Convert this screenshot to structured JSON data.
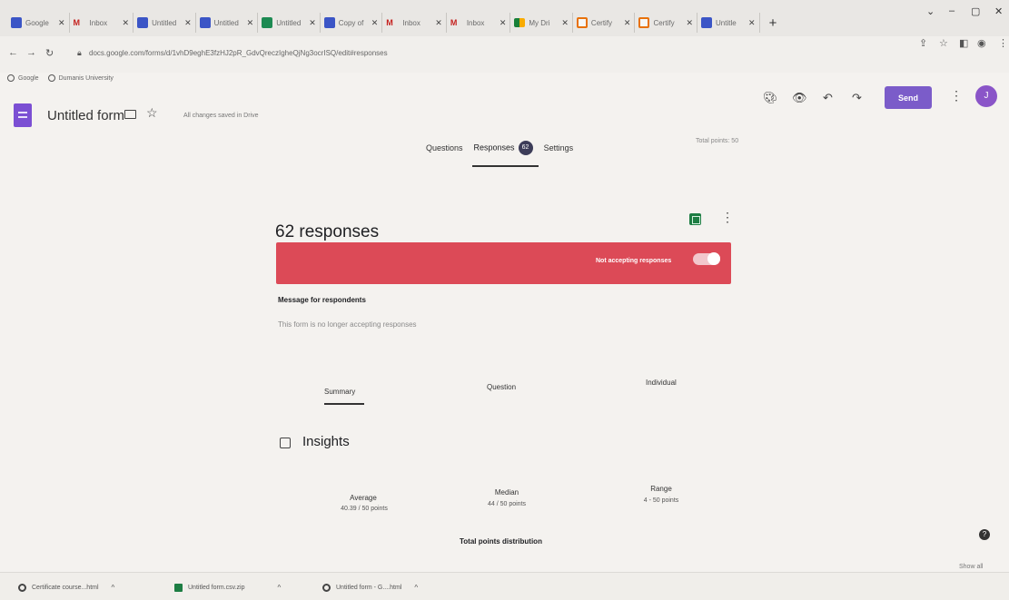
{
  "browser": {
    "tabs": [
      {
        "label": "Google",
        "icon": "form-favicon"
      },
      {
        "label": "Inbox",
        "icon": "gmail-favicon"
      },
      {
        "label": "Untitled",
        "icon": "form-favicon"
      },
      {
        "label": "Untitled",
        "icon": "form-favicon"
      },
      {
        "label": "Untitled",
        "icon": "sheet-favicon"
      },
      {
        "label": "Copy of",
        "icon": "form-favicon"
      },
      {
        "label": "Inbox",
        "icon": "gmail-favicon"
      },
      {
        "label": "Inbox",
        "icon": "gmail-favicon"
      },
      {
        "label": "My Dri",
        "icon": "drive-favicon"
      },
      {
        "label": "Certify",
        "icon": "cert-favicon"
      },
      {
        "label": "Certify",
        "icon": "cert-favicon"
      },
      {
        "label": "Untitle",
        "icon": "form-favicon"
      }
    ],
    "new_tab": "+",
    "url": "docs.google.com/forms/d/1vhD9eghE3fzHJ2pR_GdvQreczIgheQjNg3ocrISQ/edit#responses",
    "bookmarks": [
      "Google",
      "Dumanis University"
    ]
  },
  "form": {
    "title": "Untitled form",
    "saved_note": "All changes saved in Drive",
    "send_label": "Send",
    "avatar_initial": "J",
    "tabs": {
      "questions": "Questions",
      "responses": "Responses",
      "settings": "Settings"
    },
    "response_count_badge": "62",
    "total_points": "Total points: 50"
  },
  "responses": {
    "title": "62 responses",
    "accepting_label": "Not accepting responses",
    "accepting": false,
    "message_label": "Message for respondents",
    "message_text": "This form is no longer accepting responses",
    "subtabs": {
      "summary": "Summary",
      "question": "Question",
      "individual": "Individual"
    },
    "insights_title": "Insights",
    "stats": [
      {
        "label": "Average",
        "value": "40.39 / 50 points"
      },
      {
        "label": "Median",
        "value": "44 / 50 points"
      },
      {
        "label": "Range",
        "value": "4 - 50 points"
      }
    ],
    "distribution_title": "Total points distribution",
    "show_all": "Show all"
  },
  "downloads": [
    {
      "name": "Certificate course...html",
      "icon": "chrome-icon"
    },
    {
      "name": "Untitled form.csv.zip",
      "icon": "sheet-icon"
    },
    {
      "name": "Untitled form - G....html",
      "icon": "chrome-icon"
    }
  ],
  "colors": {
    "banner": "#dc4a57",
    "accent": "#7b5cc9",
    "sheets": "#1d7d43"
  }
}
